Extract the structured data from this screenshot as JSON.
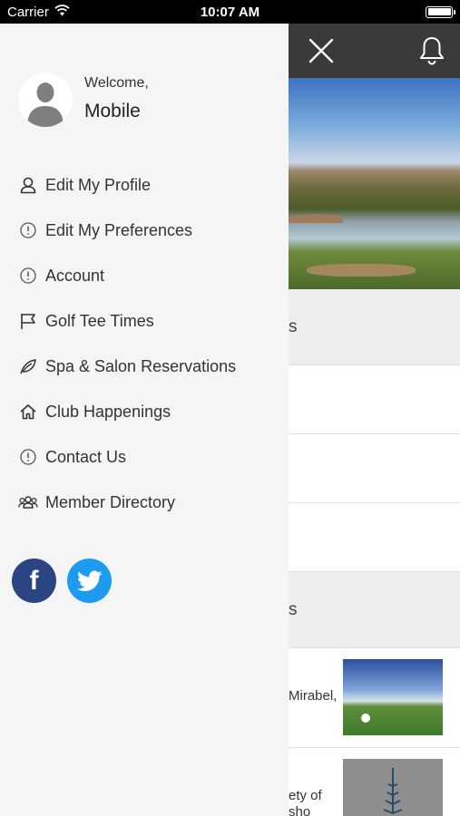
{
  "status_bar": {
    "carrier": "Carrier",
    "time": "10:07 AM"
  },
  "drawer": {
    "welcome": "Welcome,",
    "username": "Mobile",
    "menu": [
      {
        "label": "Edit My Profile",
        "icon": "user-icon"
      },
      {
        "label": "Edit My Preferences",
        "icon": "info-circle-icon"
      },
      {
        "label": "Account",
        "icon": "info-circle-icon"
      },
      {
        "label": "Golf Tee Times",
        "icon": "flag-icon"
      },
      {
        "label": "Spa & Salon Reservations",
        "icon": "leaf-icon"
      },
      {
        "label": "Club Happenings",
        "icon": "home-icon"
      },
      {
        "label": "Contact Us",
        "icon": "info-circle-icon"
      },
      {
        "label": "Member Directory",
        "icon": "group-icon"
      }
    ],
    "social": {
      "facebook_glyph": "f"
    }
  },
  "main": {
    "section1_fragment": "s",
    "section2_fragment": "s",
    "news": [
      {
        "text_fragment": "Mirabel,"
      },
      {
        "text_fragment_1": "ety of",
        "text_fragment_2": "sho"
      }
    ]
  },
  "colors": {
    "facebook": "#2b4482",
    "twitter": "#1d9bf0",
    "topbar": "#3a3a3a"
  }
}
